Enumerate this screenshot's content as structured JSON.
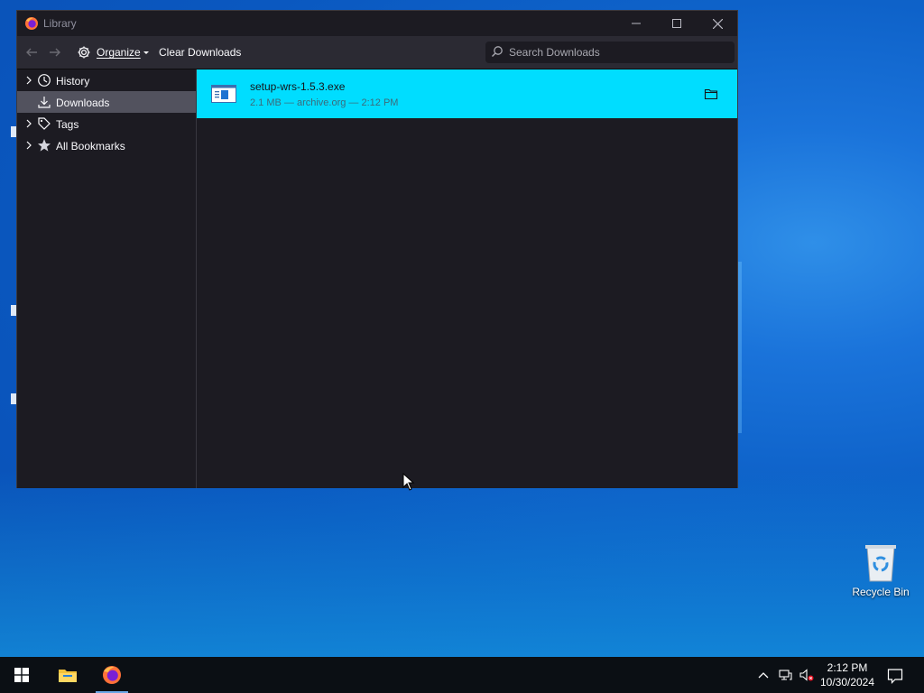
{
  "window": {
    "title": "Library"
  },
  "toolbar": {
    "organize_label": "Organize",
    "clear_downloads_label": "Clear Downloads",
    "search_placeholder": "Search Downloads"
  },
  "sidebar": {
    "items": [
      {
        "label": "History",
        "icon": "clock-icon",
        "expandable": true
      },
      {
        "label": "Downloads",
        "icon": "download-icon",
        "expandable": false,
        "selected": true
      },
      {
        "label": "Tags",
        "icon": "tag-icon",
        "expandable": true
      },
      {
        "label": "All Bookmarks",
        "icon": "star-icon",
        "expandable": true
      }
    ]
  },
  "downloads": [
    {
      "filename": "setup-wrs-1.5.3.exe",
      "status": "2.1 MB — archive.org — 2:12 PM"
    }
  ],
  "desktop": {
    "recycle_bin_label": "Recycle Bin"
  },
  "taskbar": {
    "time": "2:12 PM",
    "date": "10/30/2024"
  },
  "colors": {
    "accent_selected_download": "#00ddff",
    "window_bg": "#1c1b22",
    "toolbar_bg": "#2b2a33",
    "taskbar_bg": "#0b0f14"
  }
}
